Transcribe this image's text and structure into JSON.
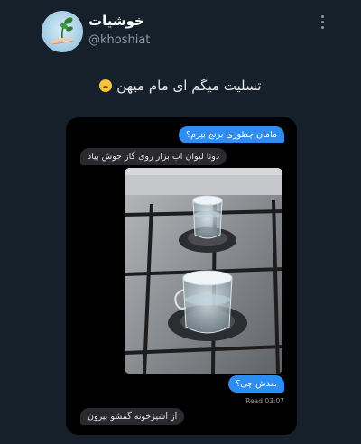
{
  "author": {
    "display_name": "خوشیات",
    "handle": "@khoshiat"
  },
  "tweet": {
    "text": "تسلیت میگم ای مام میهن",
    "emoji": "crying-face-icon"
  },
  "chat": {
    "messages": [
      {
        "side": "sent",
        "text": "مامان چطوری برنج بپزم؟"
      },
      {
        "side": "received",
        "text": "دوتا لیوان اب بزار روی گاز جوش بیاد"
      },
      {
        "side": "sent",
        "text": "بعدش چی؟"
      },
      {
        "side": "received",
        "text": "از اشپزخونه گمشو بیرون"
      }
    ],
    "read_receipt": "Read 03:07",
    "photo": "stove-with-two-glasses-of-water"
  },
  "colors": {
    "background": "#15202b",
    "sent_bubble": "#2f8cf0",
    "received_bubble": "#2a2a2e"
  }
}
